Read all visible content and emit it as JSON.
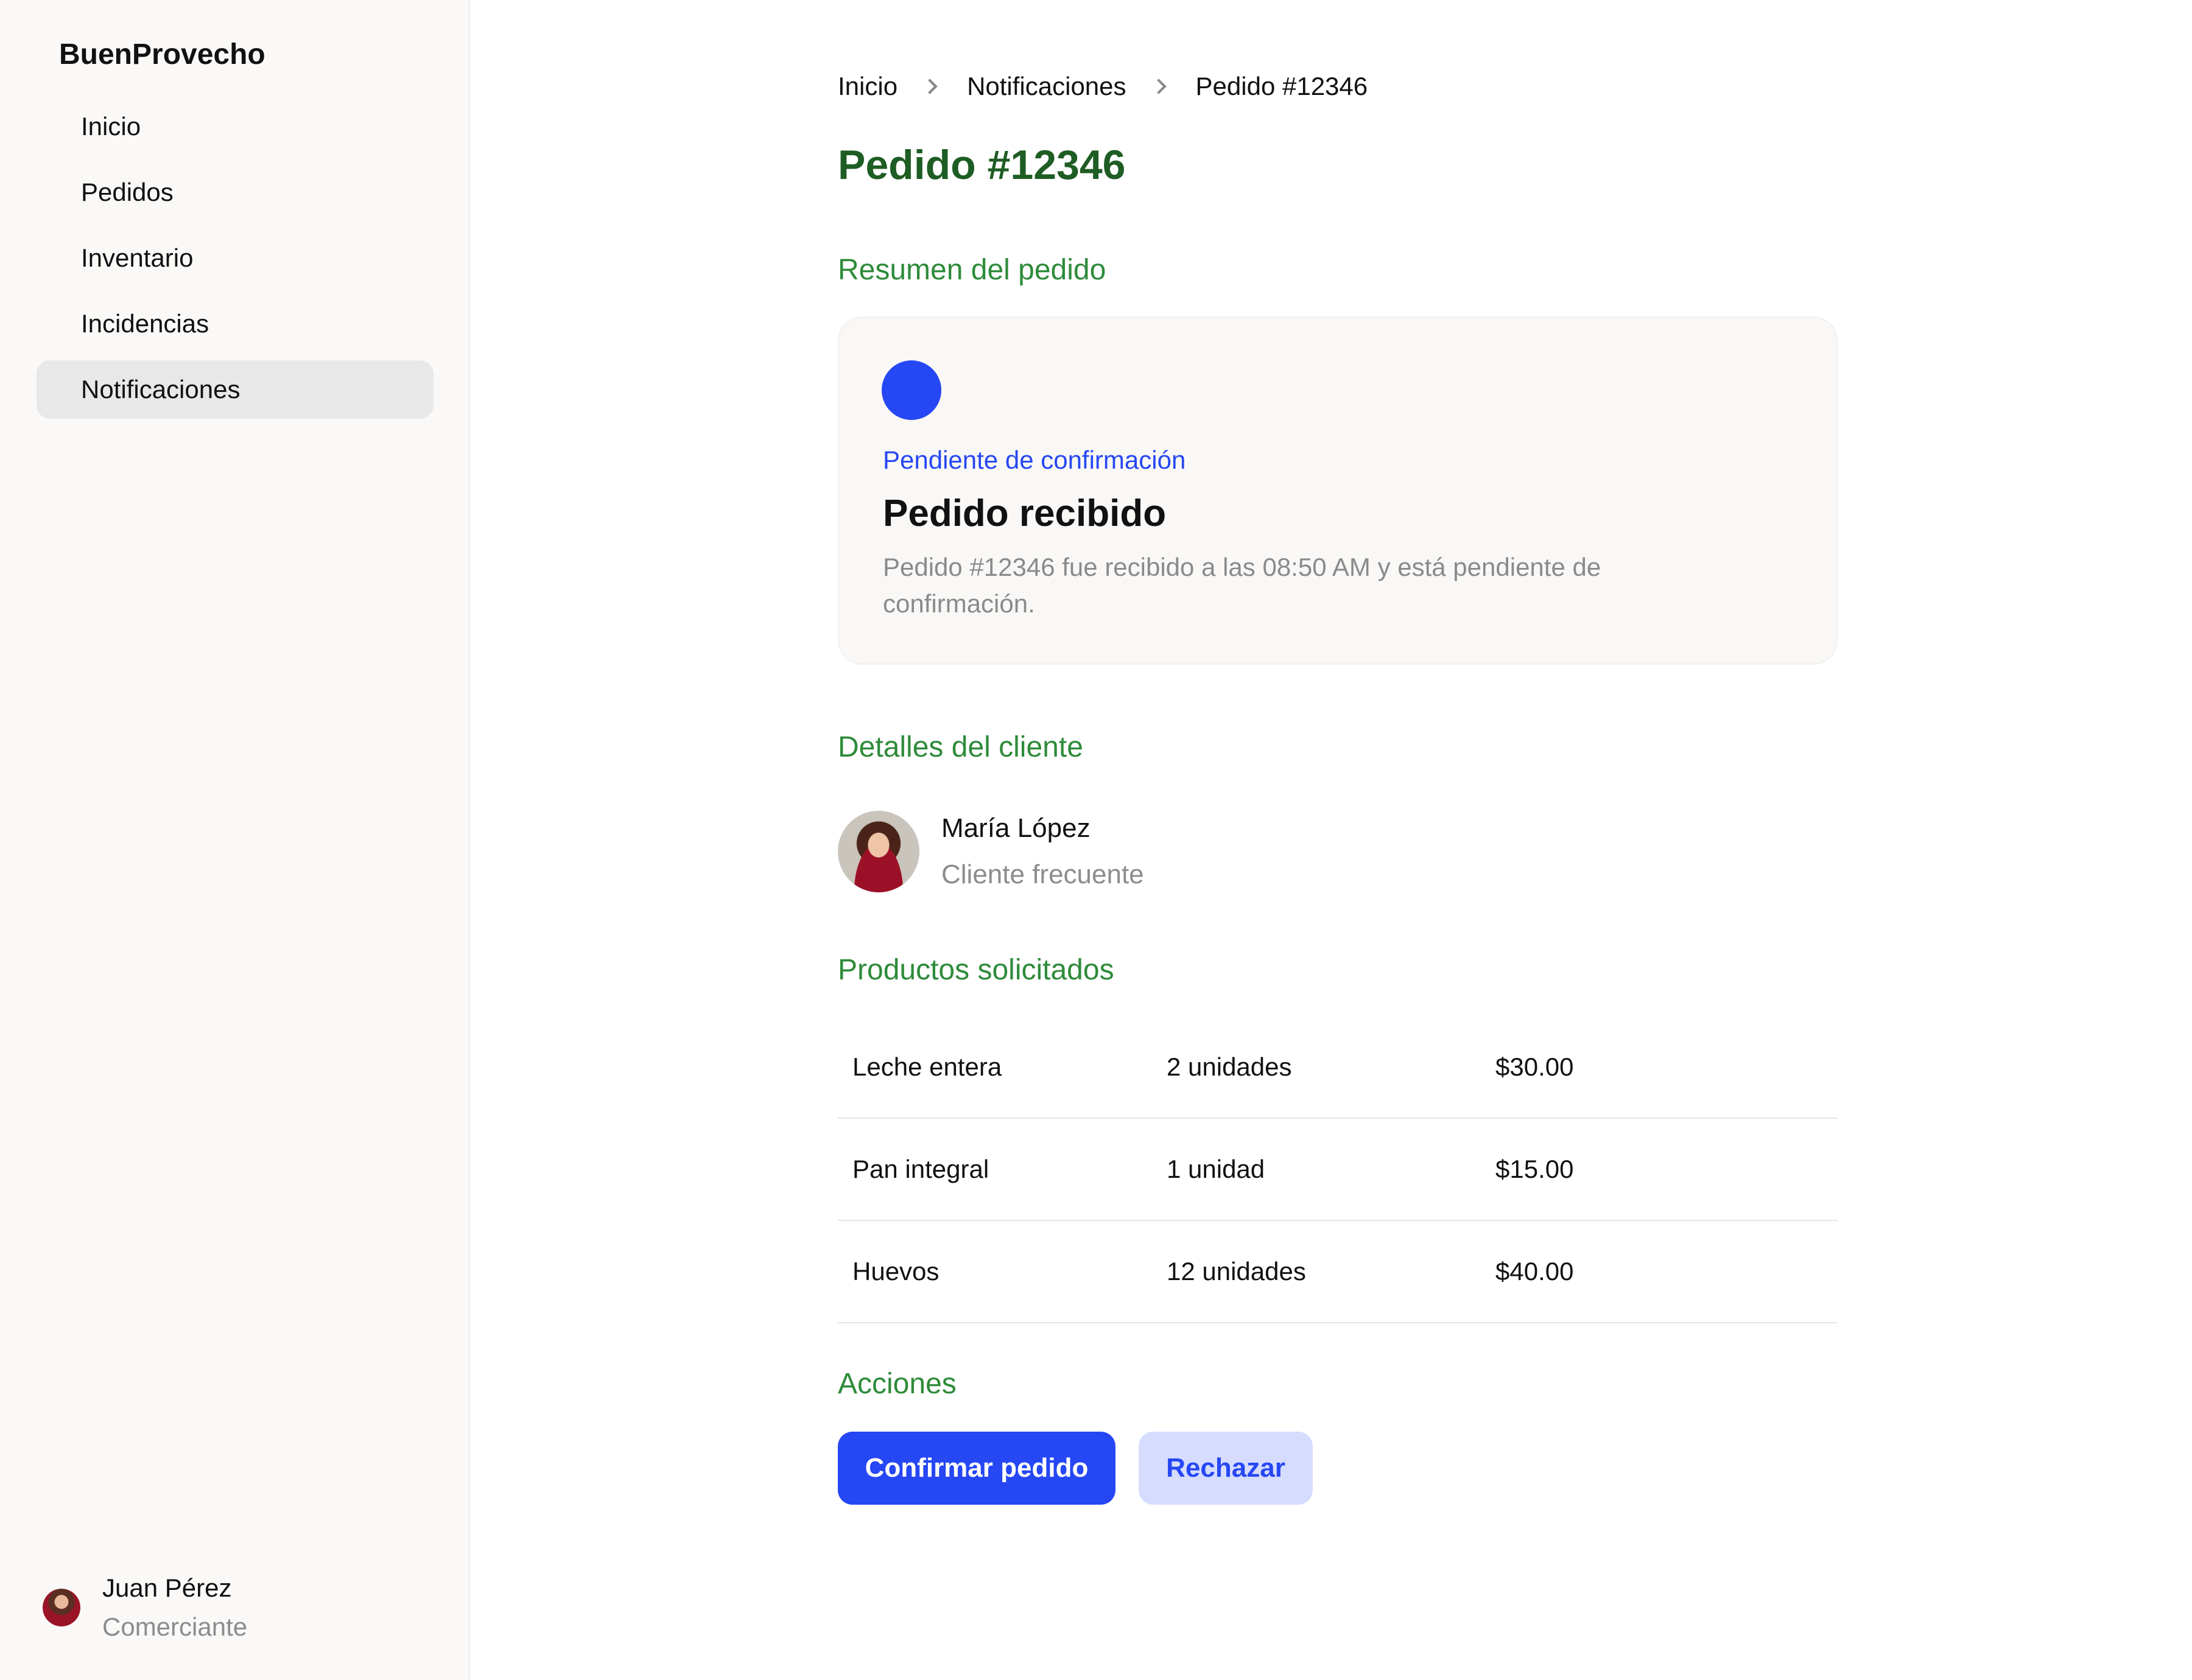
{
  "app": {
    "brand": "BuenProvecho"
  },
  "sidebar": {
    "items": [
      {
        "label": "Inicio"
      },
      {
        "label": "Pedidos"
      },
      {
        "label": "Inventario"
      },
      {
        "label": "Incidencias"
      },
      {
        "label": "Notificaciones",
        "active": true
      }
    ],
    "user": {
      "name": "Juan Pérez",
      "role": "Comerciante"
    }
  },
  "breadcrumb": [
    "Inicio",
    "Notificaciones",
    "Pedido #12346"
  ],
  "page": {
    "title": "Pedido #12346"
  },
  "summary": {
    "section_title": "Resumen del pedido",
    "status": "Pendiente de confirmación",
    "status_color": "#2647f4",
    "title": "Pedido recibido",
    "description": "Pedido #12346 fue recibido a las 08:50 AM y está pendiente de confirmación."
  },
  "client": {
    "section_title": "Detalles del cliente",
    "name": "María López",
    "type": "Cliente frecuente"
  },
  "products": {
    "section_title": "Productos solicitados",
    "rows": [
      {
        "name": "Leche entera",
        "qty": "2 unidades",
        "price": "$30.00"
      },
      {
        "name": "Pan integral",
        "qty": "1 unidad",
        "price": "$15.00"
      },
      {
        "name": "Huevos",
        "qty": "12 unidades",
        "price": "$40.00"
      }
    ]
  },
  "actions": {
    "section_title": "Acciones",
    "confirm_label": "Confirmar pedido",
    "reject_label": "Rechazar"
  },
  "colors": {
    "accent": "#2647f4",
    "title_green": "#1e5d24",
    "section_green": "#2e8b3a"
  }
}
